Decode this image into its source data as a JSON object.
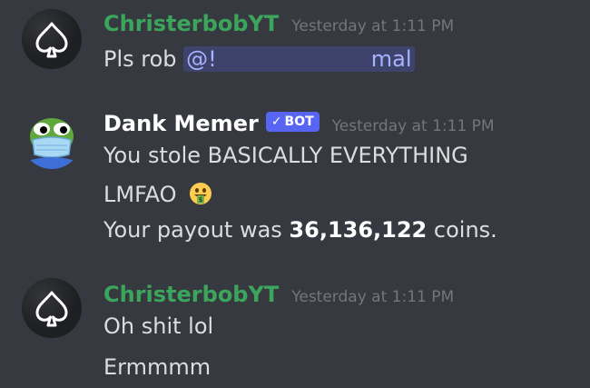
{
  "messages": [
    {
      "username": "ChristerbobYT",
      "username_color": "#3ba55c",
      "timestamp": "Yesterday at 1:11 PM",
      "avatar_icon": "spade-icon",
      "mention_start": "@!",
      "mention_end": "mal",
      "text": "Pls rob"
    },
    {
      "username": "Dank Memer",
      "username_color": "#ffffff",
      "bot_tag": "BOT",
      "timestamp": "Yesterday at 1:11 PM",
      "avatar_icon": "pepe-mask-icon",
      "line1": "You stole BASICALLY EVERYTHING",
      "line2": "LMFAO",
      "emoji": "money-mouth-face-icon",
      "line3_prefix": "Your payout was",
      "line3_amount": "36,136,122",
      "line3_suffix": "coins."
    },
    {
      "username": "ChristerbobYT",
      "username_color": "#3ba55c",
      "timestamp": "Yesterday at 1:11 PM",
      "avatar_icon": "spade-icon",
      "line1": "Oh shit lol",
      "line2": "Ermmmm"
    }
  ]
}
